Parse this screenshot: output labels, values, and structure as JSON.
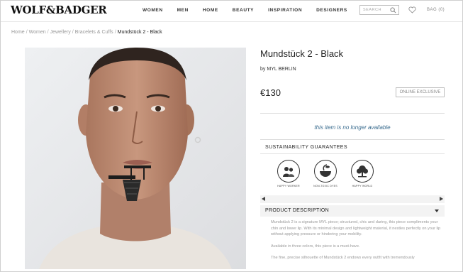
{
  "brand": {
    "logo_text": "WOLF&BADGER"
  },
  "nav": {
    "items": [
      "WOMEN",
      "MEN",
      "HOME",
      "BEAUTY",
      "INSPIRATION",
      "DESIGNERS"
    ]
  },
  "search": {
    "placeholder": "SEARCH"
  },
  "bag": {
    "label": "BAG (0)"
  },
  "breadcrumb": {
    "items": [
      "Home",
      "Women",
      "Jewellery",
      "Bracelets & Cuffs"
    ],
    "current": "Mundstück 2 - Black",
    "separator": "/"
  },
  "product": {
    "title": "Mundstück 2 - Black",
    "byline_prefix": "by",
    "designer": "MYL BERLIN",
    "price": "€130",
    "exclusive_badge": "ONLINE EXCLUSIVE",
    "availability": "this item is no longer available"
  },
  "sustainability": {
    "title": "SUSTAINABILITY GUARANTEES",
    "badges": [
      {
        "label": "HAPPY WORKER",
        "icon": "happy-worker-icon"
      },
      {
        "label": "NON-TOXIC DYES",
        "icon": "non-toxic-dyes-icon"
      },
      {
        "label": "HAPPY WORLD",
        "icon": "happy-world-icon"
      }
    ]
  },
  "description": {
    "title": "PRODUCT DESCRIPTION",
    "paragraphs": [
      "Mundstück 2 is a signature MYL piece; structured, chic and daring, this piece compliments your chin and lower lip. With its minimal design and lightweight material, it nestles perfectly on your lip without applying pressure or hindering your mobility.",
      "Available in three colors, this piece is a must-have.",
      "The fine, precise silhouette of Mundstück 2 endows every outfit with tremendously"
    ]
  },
  "colors": {
    "link_blue": "#3a6c8f",
    "image_bg": "#e6e7e9",
    "text_dark": "#222222"
  }
}
